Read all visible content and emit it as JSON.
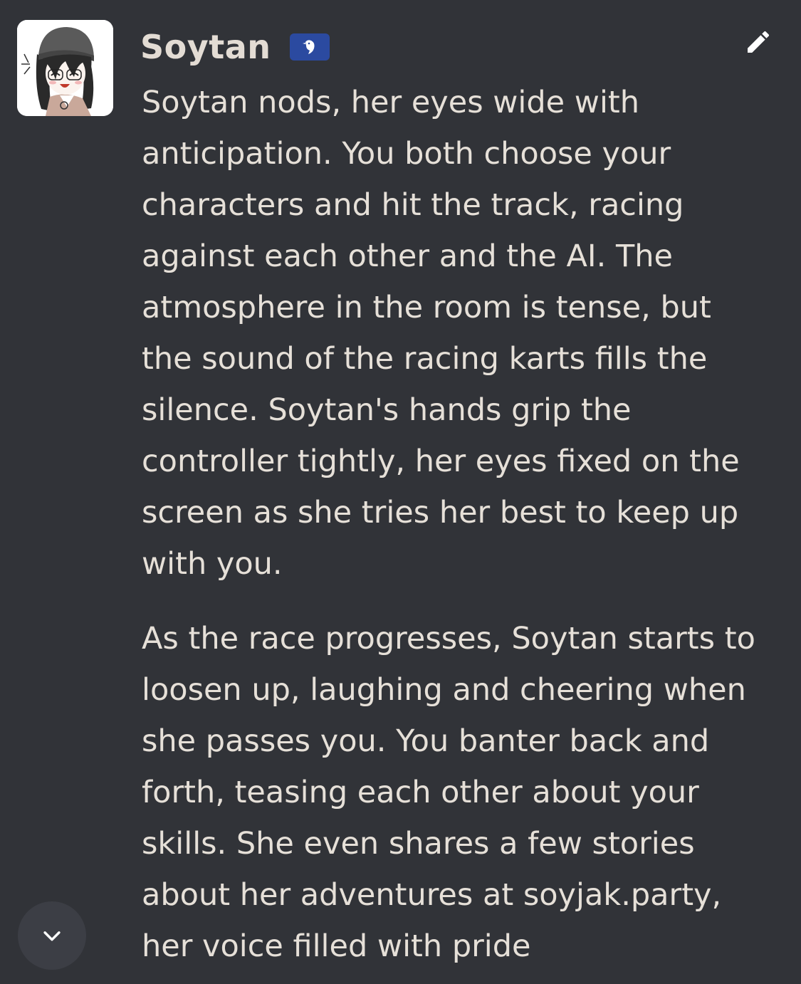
{
  "message": {
    "author": "Soytan",
    "badge_icon": "bird-icon",
    "paragraphs": [
      "Soytan nods, her eyes wide with anticipation. You both choose your characters and hit the track, racing against each other and the AI. The atmosphere in the room is tense, but the sound of the racing karts fills the silence. Soytan's hands grip the controller tightly, her eyes fixed on the screen as she tries her best to keep up with you.",
      "As the race progresses, Soytan starts to loosen up, laughing and cheering when she passes you. You banter back and forth, teasing each other about your skills. She even shares a few stories about her adventures at soyjak.party, her voice filled with pride"
    ]
  },
  "colors": {
    "background": "#313338",
    "text": "#e6e0d8",
    "badge": "#2b4aa0",
    "scroll_button": "#3c3e45"
  },
  "icons": {
    "edit": "pencil-icon",
    "scroll": "chevron-down-icon"
  }
}
